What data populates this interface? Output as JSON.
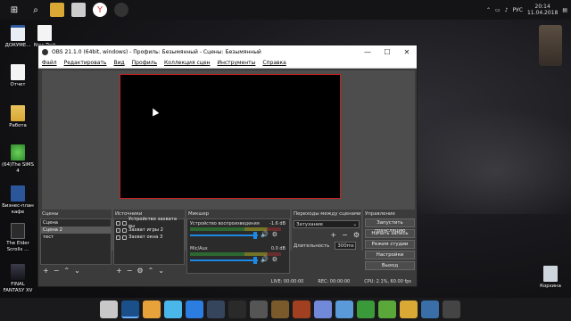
{
  "top_bar": {
    "icons": [
      "windows-icon",
      "search-icon",
      "folder-icon",
      "mail-icon",
      "yandex-icon",
      "obs-icon"
    ],
    "tray": {
      "language": "РУС",
      "time": "20:14",
      "date": "11.04.2018"
    }
  },
  "desktop_icons": [
    {
      "name": "desktop-icon-document",
      "label": "ДОКУМЕ...",
      "icon": "word-icon"
    },
    {
      "name": "desktop-icon-new-text",
      "label": "New Text",
      "icon": "text-icon"
    },
    {
      "name": "desktop-icon-report",
      "label": "Отчет",
      "icon": "text-icon"
    },
    {
      "name": "desktop-icon-work",
      "label": "Работа",
      "icon": "folder-icon"
    },
    {
      "name": "desktop-icon-sims",
      "label": "(64)The SIMS 4",
      "icon": "sims-icon"
    },
    {
      "name": "desktop-icon-business-plan",
      "label": "Бизнес-план кафе",
      "icon": "word-icon"
    },
    {
      "name": "desktop-icon-elder-scrolls",
      "label": "The Elder Scrolls ...",
      "icon": "elder-scrolls-icon"
    },
    {
      "name": "desktop-icon-final-fantasy",
      "label": "FINAL FANTASY XV",
      "icon": "final-fantasy-icon"
    },
    {
      "name": "desktop-icon-recycle-bin",
      "label": "Корзина",
      "icon": "recycle-bin-icon"
    }
  ],
  "obs": {
    "title": "OBS 21.1.0 (64bit, windows) - Профиль: Безымянный - Сцены: Безымянный",
    "window_controls": {
      "minimize": "—",
      "maximize": "☐",
      "close": "✕"
    },
    "menu": [
      "Файл",
      "Редактировать",
      "Вид",
      "Профиль",
      "Коллекция сцен",
      "Инструменты",
      "Справка"
    ],
    "scenes": {
      "title": "Сцены",
      "items": [
        "Сцена",
        "Сцена 2",
        "тест"
      ],
      "selected": "Сцена 2"
    },
    "sources": {
      "title": "Источники",
      "items": [
        "Устройство захвата вы",
        "Захват игры 2",
        "Захват окна 3"
      ]
    },
    "mixer": {
      "title": "Микшер",
      "channels": [
        {
          "label": "Устройство воспроизведения",
          "db": "-1.6 dB"
        },
        {
          "label": "Mic/Aux",
          "db": "0.0 dB"
        }
      ]
    },
    "transitions": {
      "title": "Переходы между сценами",
      "selected": "Затухание",
      "duration_label": "Длительность",
      "duration_value": "300ms"
    },
    "controls": {
      "title": "Управление",
      "buttons": [
        "Запустить трансляцию",
        "Начать запись",
        "Режим студии",
        "Настройки",
        "Выход"
      ]
    },
    "status": {
      "live": "LIVE: 00:00:00",
      "rec": "REC: 00:00:00",
      "cpu": "CPU: 2.1%, 60.00 fps"
    }
  },
  "taskbar_apps": [
    {
      "name": "taskbar-app-1",
      "icon": "app-icon",
      "color": "#c8c8c8"
    },
    {
      "name": "taskbar-app-visual-studio",
      "icon": "visual-studio-icon",
      "color": "#1b4f8a"
    },
    {
      "name": "taskbar-app-chrome",
      "icon": "chrome-icon",
      "color": "#e8a23a"
    },
    {
      "name": "taskbar-app-skype",
      "icon": "skype-icon",
      "color": "#4ab7ea"
    },
    {
      "name": "taskbar-app-teamviewer",
      "icon": "teamviewer-icon",
      "color": "#2b7de0"
    },
    {
      "name": "taskbar-app-steam",
      "icon": "steam-icon",
      "color": "#35465c"
    },
    {
      "name": "taskbar-app-epic",
      "icon": "epic-games-icon",
      "color": "#2a2a2a"
    },
    {
      "name": "taskbar-app-unity",
      "icon": "unity-icon",
      "color": "#555555"
    },
    {
      "name": "taskbar-app-minecraft",
      "icon": "minecraft-icon",
      "color": "#7a5a2a"
    },
    {
      "name": "taskbar-app-game",
      "icon": "game-icon",
      "color": "#a04020"
    },
    {
      "name": "taskbar-app-discord",
      "icon": "discord-icon",
      "color": "#7289da"
    },
    {
      "name": "taskbar-app-network",
      "icon": "network-icon",
      "color": "#5a9ad8"
    },
    {
      "name": "taskbar-app-greenshot",
      "icon": "greenshot-icon",
      "color": "#3a9a3a"
    },
    {
      "name": "taskbar-app-utorrent",
      "icon": "utorrent-icon",
      "color": "#5aa83a"
    },
    {
      "name": "taskbar-app-folder",
      "icon": "folder-icon",
      "color": "#d9a835"
    },
    {
      "name": "taskbar-app-app",
      "icon": "app-icon",
      "color": "#3a6ea8"
    },
    {
      "name": "taskbar-app-obs",
      "icon": "obs-icon",
      "color": "#444444"
    }
  ]
}
